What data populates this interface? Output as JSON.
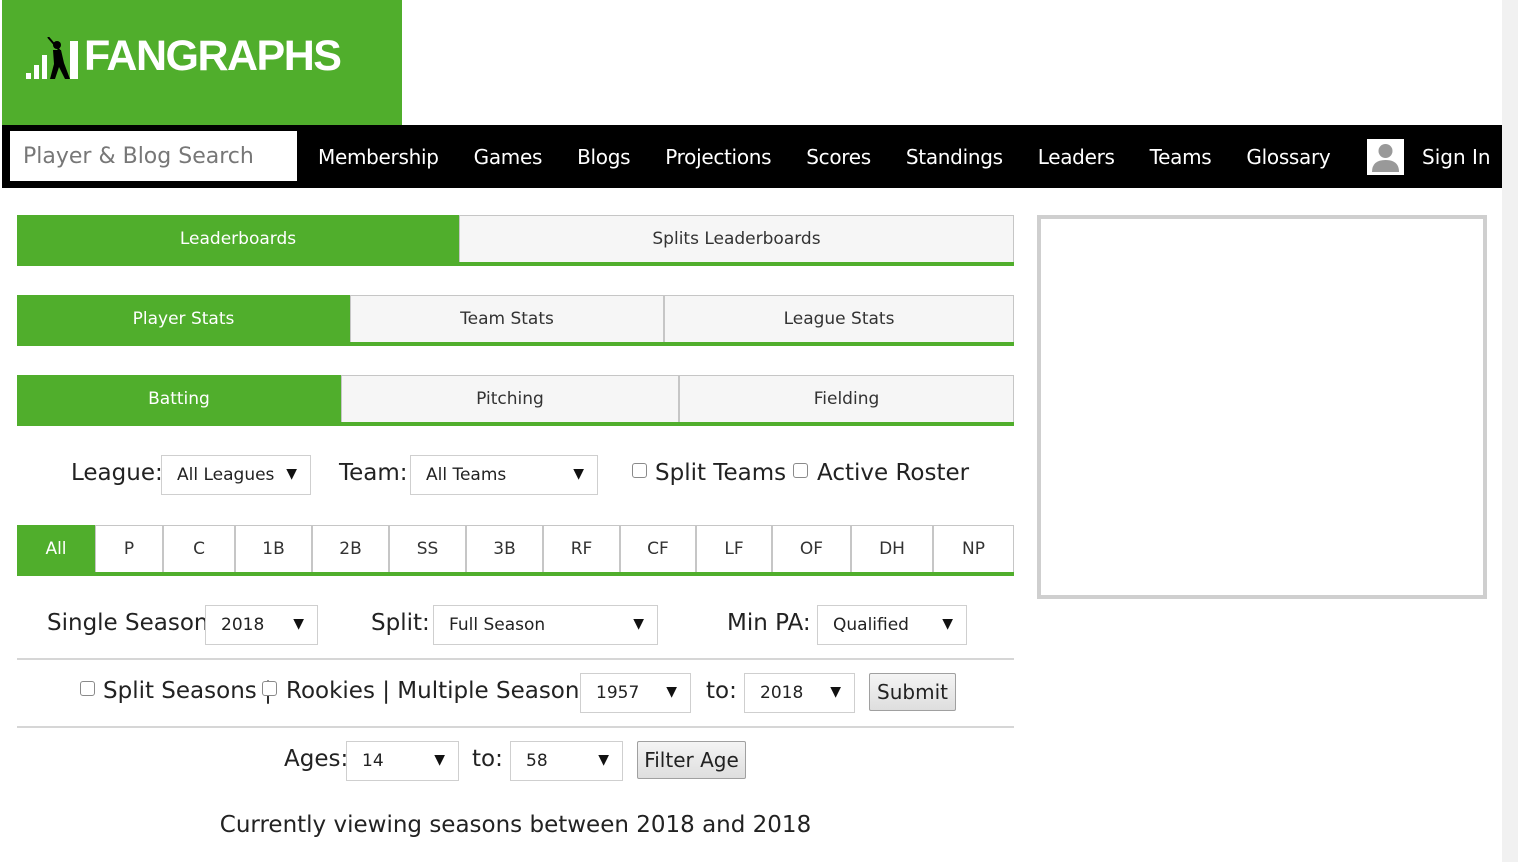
{
  "brand": {
    "logo_text": "FANGRAPHS",
    "accent": "#50ae2c"
  },
  "search": {
    "placeholder": "Player & Blog Search"
  },
  "nav": {
    "items": [
      {
        "label": "Membership"
      },
      {
        "label": "Games"
      },
      {
        "label": "Blogs"
      },
      {
        "label": "Projections"
      },
      {
        "label": "Scores"
      },
      {
        "label": "Standings"
      },
      {
        "label": "Leaders"
      },
      {
        "label": "Teams"
      },
      {
        "label": "Glossary"
      }
    ],
    "sign_in": "Sign In",
    "user_icon": "user-silhouette-icon"
  },
  "tabs_main": [
    {
      "label": "Leaderboards",
      "active": true
    },
    {
      "label": "Splits Leaderboards",
      "active": false
    }
  ],
  "tabs_stats": [
    {
      "label": "Player Stats",
      "active": true
    },
    {
      "label": "Team Stats",
      "active": false
    },
    {
      "label": "League Stats",
      "active": false
    }
  ],
  "tabs_type": [
    {
      "label": "Batting",
      "active": true
    },
    {
      "label": "Pitching",
      "active": false
    },
    {
      "label": "Fielding",
      "active": false
    }
  ],
  "filters": {
    "league_label": "League:",
    "league_value": "All Leagues",
    "team_label": "Team:",
    "team_value": "All Teams",
    "split_teams": "Split Teams",
    "active_roster": "Active Roster"
  },
  "positions": [
    "All",
    "P",
    "C",
    "1B",
    "2B",
    "SS",
    "3B",
    "RF",
    "CF",
    "LF",
    "OF",
    "DH",
    "NP"
  ],
  "season": {
    "single_label": "Single Season:",
    "single_value": "2018",
    "split_label": "Split:",
    "split_value": "Full Season",
    "minpa_label": "Min PA:",
    "minpa_value": "Qualified"
  },
  "multi": {
    "split_seasons": "Split Seasons |",
    "rookies": "Rookies | Multiple Seasons:",
    "from_value": "1957",
    "to_label": "to:",
    "to_value": "2018",
    "submit": "Submit"
  },
  "ages": {
    "label": "Ages:",
    "from_value": "14",
    "to_label": "to:",
    "to_value": "58",
    "filter_button": "Filter Age"
  },
  "viewing_text": "Currently viewing seasons between 2018 and 2018",
  "dropdown_arrow": "▼"
}
